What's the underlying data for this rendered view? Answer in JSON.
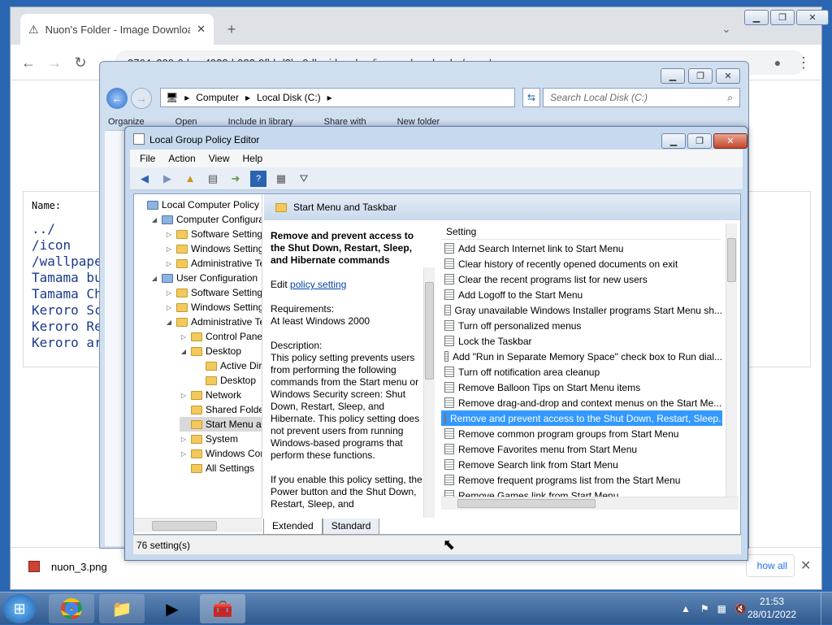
{
  "chrome": {
    "tab_title": "Nuon's Folder - Image Downloac",
    "url": "3764c309-0dae-4928-b982-9fbbd2be9dbe.id.repl.co/image-downloader/nuon/",
    "page": {
      "name_label": "Name:",
      "files": [
        "../",
        "/icon",
        "/wallpape",
        "Tamama bu",
        "Tamama Ch",
        "Keroro Sc",
        "Keroro Re",
        "Keroro ar"
      ]
    },
    "download": {
      "file": "nuon_3.png",
      "show_all": "how all"
    }
  },
  "explorer": {
    "breadcrumb": [
      "Computer",
      "Local Disk (C:)"
    ],
    "search_placeholder": "Search Local Disk (C:)",
    "toolbar": [
      "Organize",
      "Open",
      "Include in library",
      "Share with",
      "New folder"
    ]
  },
  "gpe": {
    "title": "Local Group Policy Editor",
    "menu": [
      "File",
      "Action",
      "View",
      "Help"
    ],
    "tree": [
      {
        "label": "Local Computer Policy",
        "level": 0,
        "arrow": ""
      },
      {
        "label": "Computer Configura",
        "level": 1,
        "arrow": "◢"
      },
      {
        "label": "Software Settings",
        "level": 2,
        "arrow": "▷"
      },
      {
        "label": "Windows Setting",
        "level": 2,
        "arrow": "▷"
      },
      {
        "label": "Administrative Te",
        "level": 2,
        "arrow": "▷"
      },
      {
        "label": "User Configuration",
        "level": 1,
        "arrow": "◢"
      },
      {
        "label": "Software Settings",
        "level": 2,
        "arrow": "▷"
      },
      {
        "label": "Windows Setting",
        "level": 2,
        "arrow": "▷"
      },
      {
        "label": "Administrative Te",
        "level": 2,
        "arrow": "◢"
      },
      {
        "label": "Control Panel",
        "level": 3,
        "arrow": "▷"
      },
      {
        "label": "Desktop",
        "level": 3,
        "arrow": "◢"
      },
      {
        "label": "Active Dir",
        "level": 4,
        "arrow": ""
      },
      {
        "label": "Desktop",
        "level": 4,
        "arrow": ""
      },
      {
        "label": "Network",
        "level": 3,
        "arrow": "▷"
      },
      {
        "label": "Shared Folder",
        "level": 3,
        "arrow": ""
      },
      {
        "label": "Start Menu ar",
        "level": 3,
        "arrow": ""
      },
      {
        "label": "System",
        "level": 3,
        "arrow": "▷"
      },
      {
        "label": "Windows Cor",
        "level": 3,
        "arrow": "▷"
      },
      {
        "label": "All Settings",
        "level": 3,
        "arrow": ""
      }
    ],
    "folder_title": "Start Menu and Taskbar",
    "description": {
      "heading": "Remove and prevent access to the Shut Down, Restart, Sleep, and Hibernate commands",
      "edit_prefix": "Edit ",
      "edit_link": "policy setting",
      "requirements_label": "Requirements:",
      "requirements": "At least Windows 2000",
      "description_label": "Description:",
      "text": "This policy setting prevents users from performing the following commands from the Start menu or Windows Security screen: Shut Down, Restart, Sleep, and Hibernate. This policy setting does not prevent users from running Windows-based programs that perform these functions.",
      "text2": "If you enable this policy setting, the Power button and the Shut Down, Restart, Sleep, and"
    },
    "settings_header": "Setting",
    "settings": [
      "Add Search Internet link to Start Menu",
      "Clear history of recently opened documents on exit",
      "Clear the recent programs list for new users",
      "Add Logoff to the Start Menu",
      "Gray unavailable Windows Installer programs Start Menu sh...",
      "Turn off personalized menus",
      "Lock the Taskbar",
      "Add \"Run in Separate Memory Space\" check box to Run dial...",
      "Turn off notification area cleanup",
      "Remove Balloon Tips on Start Menu items",
      "Remove drag-and-drop and context menus on the Start Me...",
      "Remove and prevent access to the Shut Down, Restart, Sleep...",
      "Remove common program groups from Start Menu",
      "Remove Favorites menu from Start Menu",
      "Remove Search link from Start Menu",
      "Remove frequent programs list from the Start Menu",
      "Remove Games link from Start Menu"
    ],
    "selected_index": 11,
    "tabs": [
      "Extended",
      "Standard"
    ],
    "status": "76 setting(s)"
  },
  "taskbar": {
    "time": "21:53",
    "date": "28/01/2022"
  }
}
